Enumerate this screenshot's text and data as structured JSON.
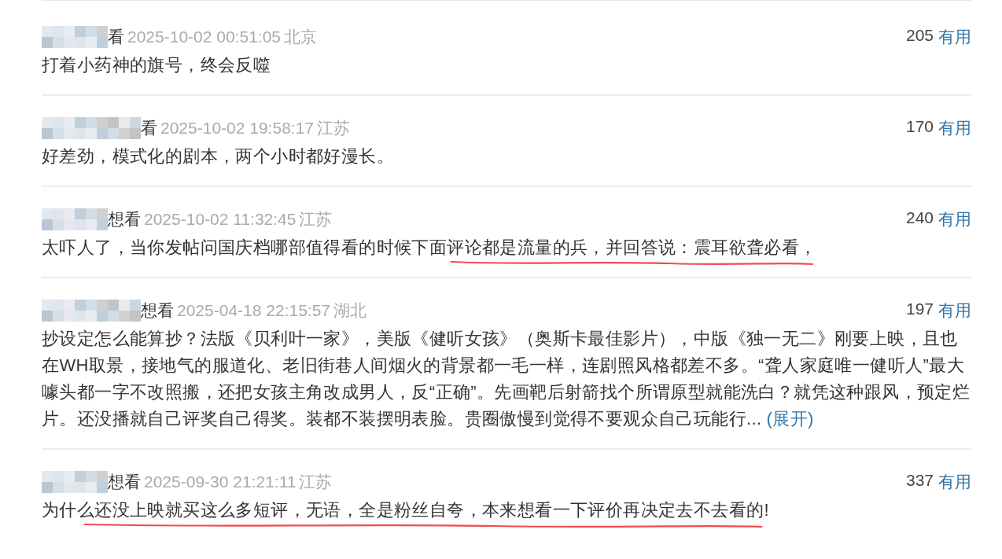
{
  "comments": [
    {
      "status": "看",
      "time": "2025-10-02 00:51:05",
      "location": "北京",
      "votes": "205",
      "vote_label": "有用",
      "segments": [
        {
          "text": "打着小药神的旗号，终会反噬",
          "marked": false
        }
      ]
    },
    {
      "status": "看",
      "time": "2025-10-02 19:58:17",
      "location": "江苏",
      "votes": "170",
      "vote_label": "有用",
      "segments": [
        {
          "text": "好差劲，模式化的剧本，两个小时都好漫长。",
          "marked": false
        }
      ]
    },
    {
      "status": "想看",
      "time": "2025-10-02 11:32:45",
      "location": "江苏",
      "votes": "240",
      "vote_label": "有用",
      "segments": [
        {
          "text": "太吓人了，当你发帖问国庆档哪部值得看的时候下面",
          "marked": false
        },
        {
          "text": "评论都是流量的兵，并回答说：震耳欲聋必看，",
          "marked": true
        }
      ]
    },
    {
      "status": "想看",
      "time": "2025-04-18 22:15:57",
      "location": "湖北",
      "votes": "197",
      "vote_label": "有用",
      "segments": [
        {
          "text": "抄设定怎么能算抄？法版《贝利叶一家》，美版《健听女孩》（奥斯卡最佳影片），中版《独一无二》刚要上映，且也在WH取景，接地气的服道化、老旧街巷人间烟火的背景都一毛一样，连剧照风格都差不多。“聋人家庭唯一健听人”最大噱头都一字不改照搬，还把女孩主角改成男人，反“正确”。先画靶后射箭找个所谓原型就能洗白？就凭这种跟风，预定烂片。还没播就自己评奖自己得奖。装都不装摆明表脸。贵圈傲慢到觉得不要观众自己玩能行...",
          "marked": false
        }
      ],
      "expand_link": "(展开)"
    },
    {
      "status": "想看",
      "time": "2025-09-30 21:21:11",
      "location": "江苏",
      "votes": "337",
      "vote_label": "有用",
      "segments": [
        {
          "text": "为什",
          "marked": false
        },
        {
          "text": "么还没上映就买这么多短评，无语，全是粉丝自夸，本来想看一下评价再决定去不去看的!",
          "marked": true
        }
      ]
    }
  ]
}
